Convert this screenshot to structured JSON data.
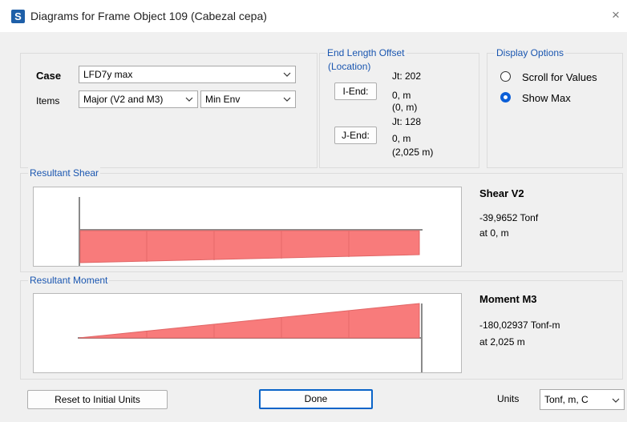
{
  "window": {
    "app_icon_letter": "S",
    "title": "Diagrams for Frame Object 109  (Cabezal cepa)",
    "close_glyph": "×"
  },
  "selection": {
    "case_label": "Case",
    "case_value": "LFD7y max",
    "items_label": "Items",
    "items_value": "Major (V2 and M3)",
    "env_value": "Min Env"
  },
  "end_offset": {
    "title_line1": "End Length Offset",
    "title_line2": "(Location)",
    "i_end_button": "I-End:",
    "i_jt": "Jt:  202",
    "i_offset": "0, m",
    "i_location": "(0, m)",
    "j_end_button": "J-End:",
    "j_jt": "Jt:  128",
    "j_offset": "0, m",
    "j_location": "(2,025 m)"
  },
  "display_options": {
    "title": "Display Options",
    "option_scroll": "Scroll for Values",
    "option_max": "Show Max",
    "selected": "Show Max"
  },
  "shear": {
    "group_label": "Resultant Shear",
    "title": "Shear V2",
    "value": "-39,9652 Tonf",
    "location": "at 0, m",
    "fill_color": "#f87b7b"
  },
  "moment": {
    "group_label": "Resultant Moment",
    "title": "Moment M3",
    "value": "-180,02937 Tonf-m",
    "location": "at 2,025 m",
    "fill_color": "#f87b7b"
  },
  "footer": {
    "reset_button": "Reset to Initial Units",
    "done_button": "Done",
    "units_label": "Units",
    "units_value": "Tonf, m, C"
  },
  "icons": {
    "app": "sap-s-icon",
    "close": "close-icon",
    "dropdown": "chevron-down-icon"
  }
}
